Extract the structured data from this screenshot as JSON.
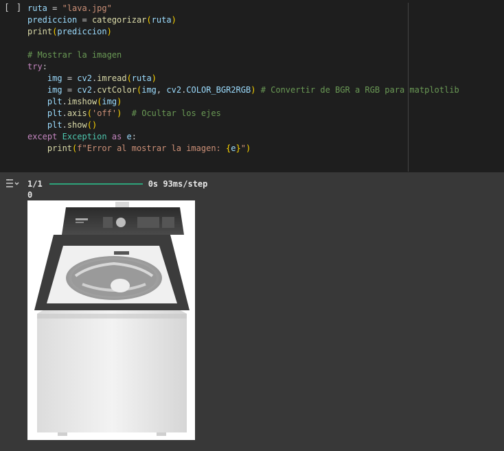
{
  "cell": {
    "run_button_label": "[ ]",
    "code_lines": [
      [
        {
          "t": "ruta",
          "c": "v"
        },
        {
          "t": " = ",
          "c": "d"
        },
        {
          "t": "\"lava.jpg\"",
          "c": "s"
        }
      ],
      [
        {
          "t": "prediccion",
          "c": "v"
        },
        {
          "t": " = ",
          "c": "d"
        },
        {
          "t": "categorizar",
          "c": "f"
        },
        {
          "t": "(",
          "c": "p"
        },
        {
          "t": "ruta",
          "c": "v"
        },
        {
          "t": ")",
          "c": "p"
        }
      ],
      [
        {
          "t": "print",
          "c": "f"
        },
        {
          "t": "(",
          "c": "p"
        },
        {
          "t": "prediccion",
          "c": "v"
        },
        {
          "t": ")",
          "c": "p"
        }
      ],
      [],
      [
        {
          "t": "# Mostrar la imagen",
          "c": "c"
        }
      ],
      [
        {
          "t": "try",
          "c": "k"
        },
        {
          "t": ":",
          "c": "d"
        }
      ],
      [
        {
          "t": "    ",
          "c": "d"
        },
        {
          "t": "img",
          "c": "v"
        },
        {
          "t": " = ",
          "c": "d"
        },
        {
          "t": "cv2",
          "c": "v"
        },
        {
          "t": ".",
          "c": "d"
        },
        {
          "t": "imread",
          "c": "f"
        },
        {
          "t": "(",
          "c": "p"
        },
        {
          "t": "ruta",
          "c": "v"
        },
        {
          "t": ")",
          "c": "p"
        }
      ],
      [
        {
          "t": "    ",
          "c": "d"
        },
        {
          "t": "img",
          "c": "v"
        },
        {
          "t": " = ",
          "c": "d"
        },
        {
          "t": "cv2",
          "c": "v"
        },
        {
          "t": ".",
          "c": "d"
        },
        {
          "t": "cvtColor",
          "c": "f"
        },
        {
          "t": "(",
          "c": "p"
        },
        {
          "t": "img",
          "c": "v"
        },
        {
          "t": ", ",
          "c": "d"
        },
        {
          "t": "cv2",
          "c": "v"
        },
        {
          "t": ".",
          "c": "d"
        },
        {
          "t": "COLOR_BGR2RGB",
          "c": "v"
        },
        {
          "t": ")",
          "c": "p"
        },
        {
          "t": " ",
          "c": "d"
        },
        {
          "t": "# Convertir de BGR a RGB para matplotlib",
          "c": "c"
        }
      ],
      [
        {
          "t": "    ",
          "c": "d"
        },
        {
          "t": "plt",
          "c": "v"
        },
        {
          "t": ".",
          "c": "d"
        },
        {
          "t": "imshow",
          "c": "f"
        },
        {
          "t": "(",
          "c": "p"
        },
        {
          "t": "img",
          "c": "v"
        },
        {
          "t": ")",
          "c": "p"
        }
      ],
      [
        {
          "t": "    ",
          "c": "d"
        },
        {
          "t": "plt",
          "c": "v"
        },
        {
          "t": ".",
          "c": "d"
        },
        {
          "t": "axis",
          "c": "f"
        },
        {
          "t": "(",
          "c": "p"
        },
        {
          "t": "'off'",
          "c": "s"
        },
        {
          "t": ")",
          "c": "p"
        },
        {
          "t": "  ",
          "c": "d"
        },
        {
          "t": "# Ocultar los ejes",
          "c": "c"
        }
      ],
      [
        {
          "t": "    ",
          "c": "d"
        },
        {
          "t": "plt",
          "c": "v"
        },
        {
          "t": ".",
          "c": "d"
        },
        {
          "t": "show",
          "c": "f"
        },
        {
          "t": "(",
          "c": "p"
        },
        {
          "t": ")",
          "c": "p"
        }
      ],
      [
        {
          "t": "except",
          "c": "k"
        },
        {
          "t": " ",
          "c": "d"
        },
        {
          "t": "Exception",
          "c": "cl"
        },
        {
          "t": " ",
          "c": "d"
        },
        {
          "t": "as",
          "c": "k"
        },
        {
          "t": " ",
          "c": "d"
        },
        {
          "t": "e",
          "c": "v"
        },
        {
          "t": ":",
          "c": "d"
        }
      ],
      [
        {
          "t": "    ",
          "c": "d"
        },
        {
          "t": "print",
          "c": "f"
        },
        {
          "t": "(",
          "c": "p"
        },
        {
          "t": "f\"Error al mostrar la imagen: ",
          "c": "s"
        },
        {
          "t": "{",
          "c": "p"
        },
        {
          "t": "e",
          "c": "v"
        },
        {
          "t": "}",
          "c": "p"
        },
        {
          "t": "\"",
          "c": "s"
        },
        {
          "t": ")",
          "c": "p"
        }
      ]
    ]
  },
  "output": {
    "icon": "output-toggle-icon",
    "progress_step": "1/1",
    "progress_fraction": 1.0,
    "progress_time": "0s 93ms/step",
    "printed_value": "0",
    "image_subject": "washing-machine"
  },
  "colors": {
    "cell_background": "#1e1e1e",
    "output_background": "#383838",
    "progress_bar": "#2ea37a"
  }
}
